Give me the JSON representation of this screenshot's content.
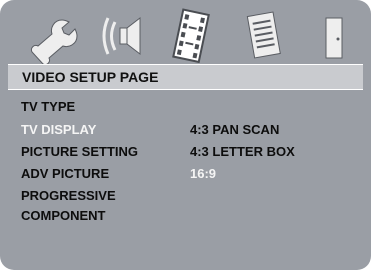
{
  "tabs": [
    {
      "icon": "wrench-icon",
      "label": ""
    },
    {
      "icon": "speaker-icon",
      "label": ""
    },
    {
      "icon": "film-icon",
      "label": "",
      "selected": true
    },
    {
      "icon": "document-icon",
      "label": ""
    },
    {
      "icon": "door-icon",
      "label": ""
    }
  ],
  "page": {
    "title": "VIDEO SETUP PAGE"
  },
  "menu": [
    {
      "label": "TV TYPE",
      "selected": false
    },
    {
      "label": "TV DISPLAY",
      "selected": true
    },
    {
      "label": "PICTURE SETTING",
      "selected": false
    },
    {
      "label": "ADV PICTURE",
      "selected": false
    },
    {
      "label": "PROGRESSIVE",
      "selected": false
    },
    {
      "label": "COMPONENT",
      "selected": false
    }
  ],
  "options": [
    {
      "label": "4:3 PAN SCAN",
      "active": false
    },
    {
      "label": "4:3 LETTER BOX",
      "active": false
    },
    {
      "label": "16:9",
      "active": true
    }
  ],
  "colors": {
    "background": "#9a9ea5",
    "header": "#c9cbcf",
    "text": "#0d0d0d",
    "highlight": "#f5f5f5"
  }
}
